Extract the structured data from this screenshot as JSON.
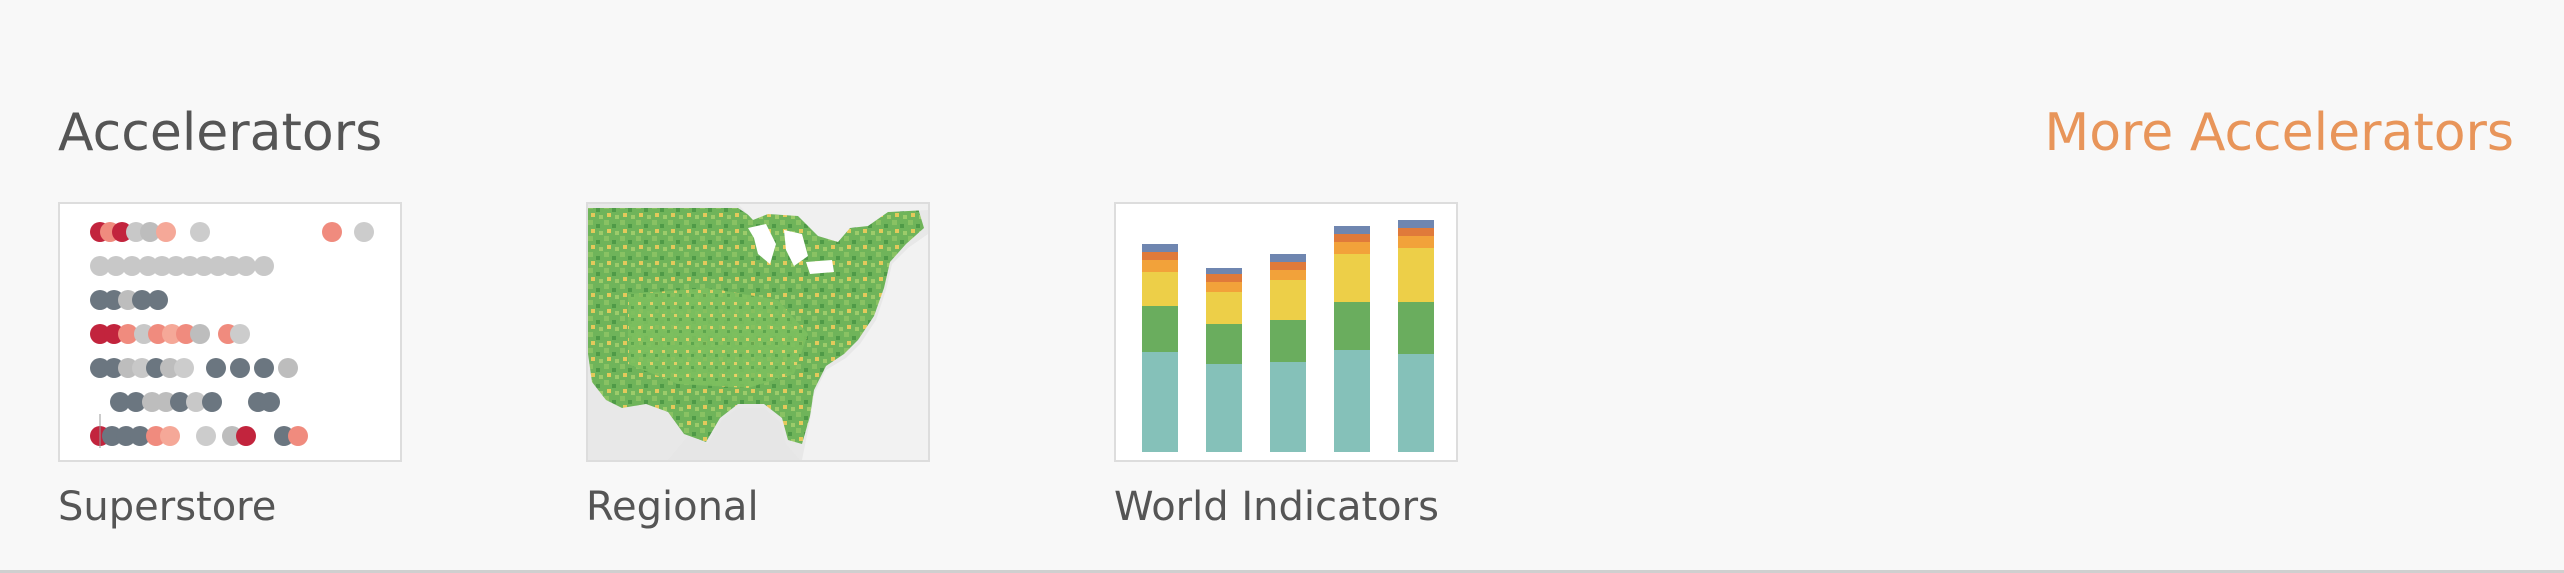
{
  "section": {
    "title": "Accelerators",
    "more_link": "More Accelerators"
  },
  "colors": {
    "title": "#555555",
    "link": "#e8955a",
    "background": "#f8f8f8"
  },
  "cards": [
    {
      "label": "Superstore",
      "thumbnail": "dot-plot-thumbnail"
    },
    {
      "label": "Regional",
      "thumbnail": "us-map-thumbnail"
    },
    {
      "label": "World Indicators",
      "thumbnail": "stacked-bar-thumbnail"
    }
  ]
}
